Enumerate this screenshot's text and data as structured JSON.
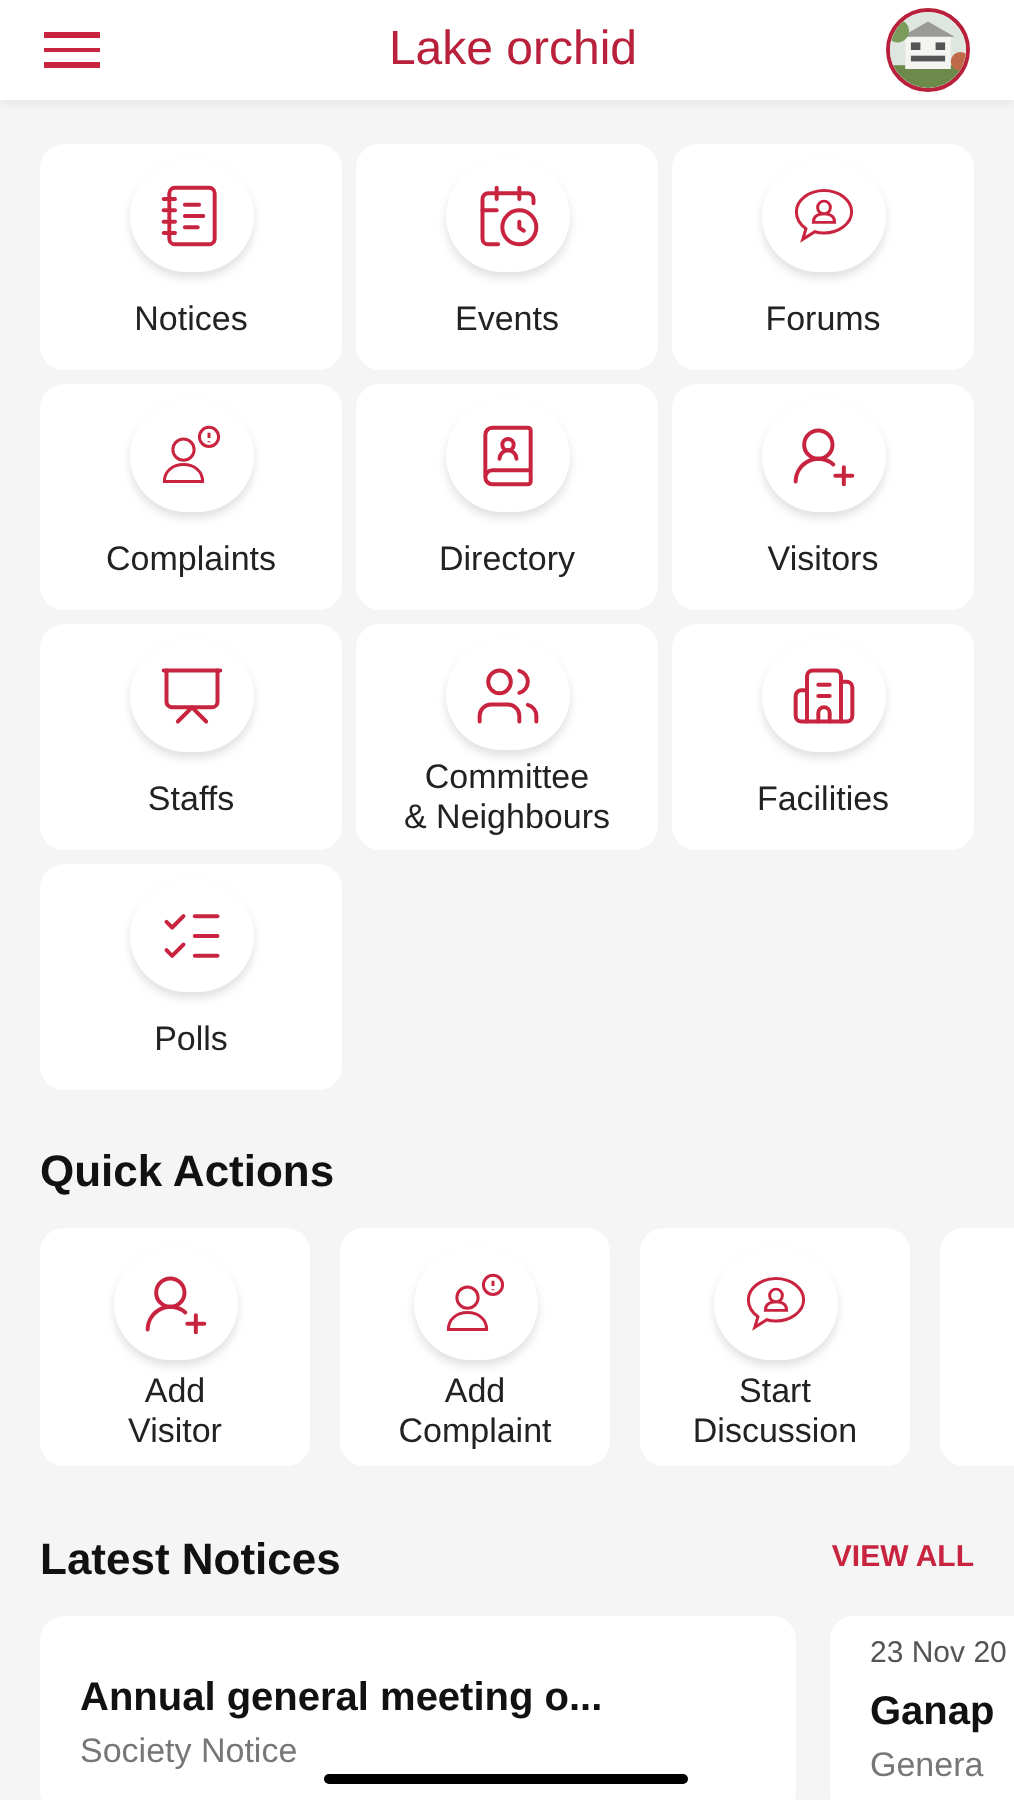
{
  "header": {
    "title": "Lake orchid"
  },
  "modules": [
    {
      "label": "Notices"
    },
    {
      "label": "Events"
    },
    {
      "label": "Forums"
    },
    {
      "label": "Complaints"
    },
    {
      "label": "Directory"
    },
    {
      "label": "Visitors"
    },
    {
      "label": "Staffs"
    },
    {
      "label": "Committee\n& Neighbours"
    },
    {
      "label": "Facilities"
    },
    {
      "label": "Polls"
    }
  ],
  "quick_actions": {
    "title": "Quick Actions",
    "items": [
      {
        "label": "Add\nVisitor"
      },
      {
        "label": "Add\nComplaint"
      },
      {
        "label": "Start\nDiscussion"
      }
    ]
  },
  "latest_notices": {
    "title": "Latest Notices",
    "link": "VIEW ALL",
    "items": [
      {
        "title": "Annual general meeting o...",
        "category": "Society Notice"
      },
      {
        "date": "23 Nov 20",
        "title": "Ganap",
        "category": "Genera"
      }
    ]
  }
}
